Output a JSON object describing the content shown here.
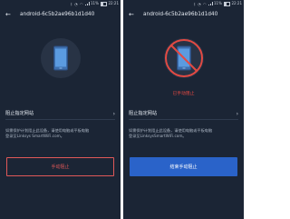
{
  "status_bar": {
    "time": "22:21",
    "battery": "11%",
    "icons": [
      "bluetooth-icon",
      "alarm-icon",
      "wifi-icon",
      "signal-icon",
      "battery-icon"
    ]
  },
  "screens": [
    {
      "title": "android-6c5b2ae96b1d1d40",
      "device_state": "allowed",
      "blocked_label": "",
      "row_label": "阻止指定网站",
      "description_lines": [
        "如需保护计划阻止此设备，请使用电脑或平板电脑",
        "登录至Linksys SmartWiFi.com。"
      ],
      "action_button": "手动阻止"
    },
    {
      "title": "android-6c5b2ae96b1d1d40",
      "device_state": "blocked",
      "blocked_label": "已手动阻止",
      "row_label": "阻止指定网站",
      "description_lines": [
        "如需保护计划阻止此设备，请使用电脑或平板电脑",
        "登录至LinksysSmartWiFi.com。"
      ],
      "action_button": "结束手动阻止"
    }
  ],
  "colors": {
    "background": "#1b2535",
    "circle": "#283345",
    "accent_red": "#e24a43",
    "button_blue": "#2a63c9",
    "text": "#e6ebf2"
  }
}
